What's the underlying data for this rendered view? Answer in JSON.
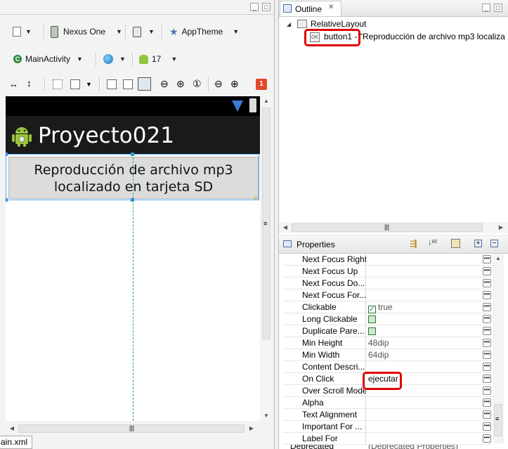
{
  "editor": {
    "toolbar_row1": {
      "device": "Nexus One",
      "theme": "AppTheme"
    },
    "toolbar_row2": {
      "activity": "MainActivity",
      "api_level": "17"
    },
    "error_badge": "1",
    "preview": {
      "app_title": "Proyecto021",
      "button_text_line1": "Reproducción de archivo mp3",
      "button_text_line2": "localizado en tarjeta SD"
    },
    "file_tab": "ain.xml"
  },
  "outline": {
    "title": "Outline",
    "tab_close": "✕",
    "root": "RelativeLayout",
    "child_id": "button1",
    "child_desc": " - \"Reproducción de archivo mp3 localiza"
  },
  "properties": {
    "title": "Properties",
    "rows": [
      {
        "name": "Next Focus Right",
        "value": ""
      },
      {
        "name": "Next Focus Up",
        "value": ""
      },
      {
        "name": "Next Focus Do...",
        "value": ""
      },
      {
        "name": "Next Focus For...",
        "value": ""
      },
      {
        "name": "Clickable",
        "value": "true",
        "checkbox": true,
        "checked": true
      },
      {
        "name": "Long Clickable",
        "value": "",
        "checkbox": true,
        "checked": false
      },
      {
        "name": "Duplicate Pare...",
        "value": "",
        "checkbox": true,
        "checked": false
      },
      {
        "name": "Min Height",
        "value": "48dip"
      },
      {
        "name": "Min Width",
        "value": "64dip"
      },
      {
        "name": "Content Descri...",
        "value": ""
      },
      {
        "name": "On Click",
        "value": "ejecutar"
      },
      {
        "name": "Over Scroll Mode",
        "value": ""
      },
      {
        "name": "Alpha",
        "value": ""
      },
      {
        "name": "Text Alignment",
        "value": ""
      },
      {
        "name": "Important For ...",
        "value": ""
      },
      {
        "name": "Label For",
        "value": ""
      }
    ],
    "cut_row_name": "Deprecated",
    "cut_row_value": "(Deprecated Properties)"
  },
  "colors": {
    "highlight": "#e00000",
    "android_bar": "#1a1a1a",
    "button_face": "#dcdcdc"
  }
}
